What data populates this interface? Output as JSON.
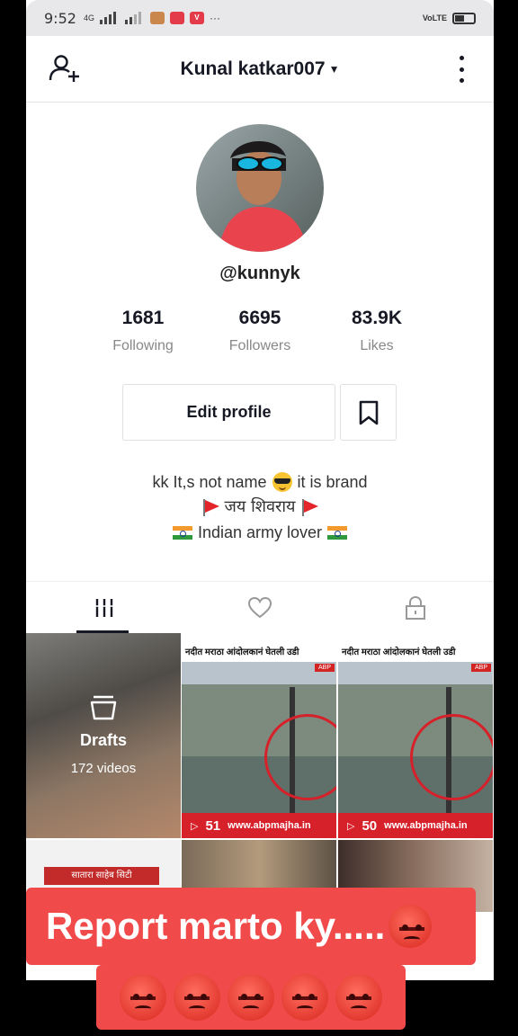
{
  "status_bar": {
    "time": "9:52",
    "network": "4G",
    "right_label": "VoLTE"
  },
  "header": {
    "title": "Kunal katkar007",
    "add_user_icon": "add-user-icon",
    "more_icon": "more-vertical-icon"
  },
  "profile": {
    "username": "@kunnyk",
    "stats": [
      {
        "value": "1681",
        "label": "Following"
      },
      {
        "value": "6695",
        "label": "Followers"
      },
      {
        "value": "83.9K",
        "label": "Likes"
      }
    ],
    "edit_label": "Edit profile",
    "bio": {
      "line1_before": "kk It,s not name",
      "line1_after": "it is brand",
      "line2": "जय शिवराय",
      "line3": "Indian army lover"
    }
  },
  "tabs": [
    {
      "icon": "grid-icon",
      "active": true
    },
    {
      "icon": "heart-icon",
      "active": false
    },
    {
      "icon": "lock-icon",
      "active": false
    }
  ],
  "grid": {
    "drafts": {
      "label": "Drafts",
      "count": "172 videos"
    },
    "news_headline": "नदीत मराठा आंदोलकानं घेतली उडी",
    "news_footer": "www.abpmajha.in",
    "news_views": "51",
    "row2_tag": "सातारा साहेब सिटी"
  },
  "overlay": {
    "caption": "Report marto ky....."
  },
  "colors": {
    "overlay_red": "#f04a4a",
    "news_red": "#d6202a"
  }
}
